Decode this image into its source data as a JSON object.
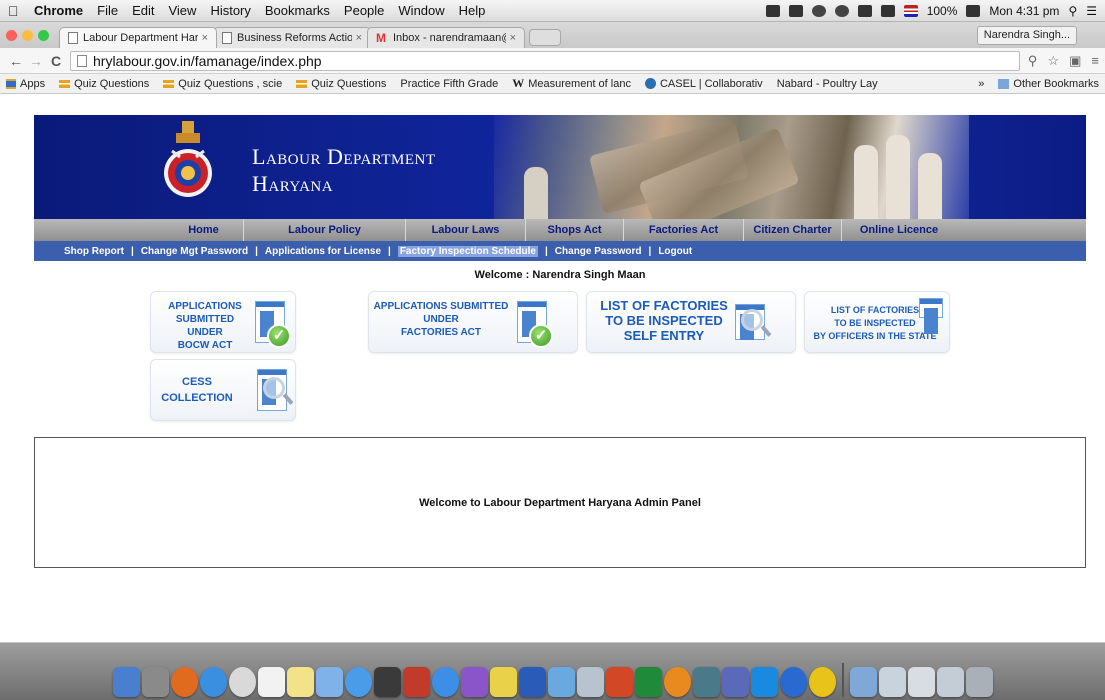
{
  "menubar": {
    "app": "Chrome",
    "menus": [
      "File",
      "Edit",
      "View",
      "History",
      "Bookmarks",
      "People",
      "Window",
      "Help"
    ],
    "battery": "100%",
    "clock": "Mon 4:31 pm"
  },
  "tabs": [
    {
      "title": "Labour Department Haryan",
      "close": "×"
    },
    {
      "title": "Business Reforms Action Pl",
      "close": "×"
    },
    {
      "title": "Inbox - narendramaan@gr",
      "close": "×"
    }
  ],
  "profile": "Narendra Singh...",
  "toolbar": {
    "url": "hrylabour.gov.in/famanage/index.php",
    "back": "←",
    "forward": "→",
    "reload": "C"
  },
  "bookmarks": {
    "items": [
      "Apps",
      "Quiz Questions",
      "Quiz Questions , scie",
      "Quiz Questions",
      "Practice Fifth Grade",
      "Measurement of lanc",
      "CASEL | Collaborativ",
      "Nabard - Poultry Lay"
    ],
    "overflow": "»",
    "other": "Other Bookmarks"
  },
  "site": {
    "title_line1": "Labour Department",
    "title_line2": "Haryana",
    "main_nav": [
      "Home",
      "Labour Policy",
      "Labour Laws",
      "Shops Act",
      "Factories Act",
      "Citizen Charter",
      "Online Licence"
    ],
    "sub_nav": [
      "Shop Report",
      "Change Mgt Password",
      "Applications for License",
      "Factory Inspection Schedule",
      "Change Password",
      "Logout"
    ],
    "sub_nav_sep": "|",
    "welcome": "Welcome : Narendra Singh Maan",
    "tiles": [
      {
        "lines": [
          "APPLICATIONS SUBMITTED",
          "UNDER",
          "BOCW ACT"
        ]
      },
      {
        "lines": [
          "APPLICATIONS SUBMITTED",
          "UNDER",
          "FACTORIES ACT"
        ]
      },
      {
        "lines": [
          "LIST OF FACTORIES",
          "TO BE INSPECTED",
          "SELF ENTRY"
        ]
      },
      {
        "lines": [
          "LIST OF FACTORIES",
          "TO BE INSPECTED",
          "BY OFFICERS IN THE STATE"
        ]
      },
      {
        "lines": [
          "CESS",
          "COLLECTION"
        ]
      }
    ],
    "panel_text": "Welcome to Labour Department Haryana Admin Panel"
  },
  "colors": {
    "banner": "#10259c",
    "subnav": "#3c5fad",
    "tile_text": "#1d5bb8"
  }
}
